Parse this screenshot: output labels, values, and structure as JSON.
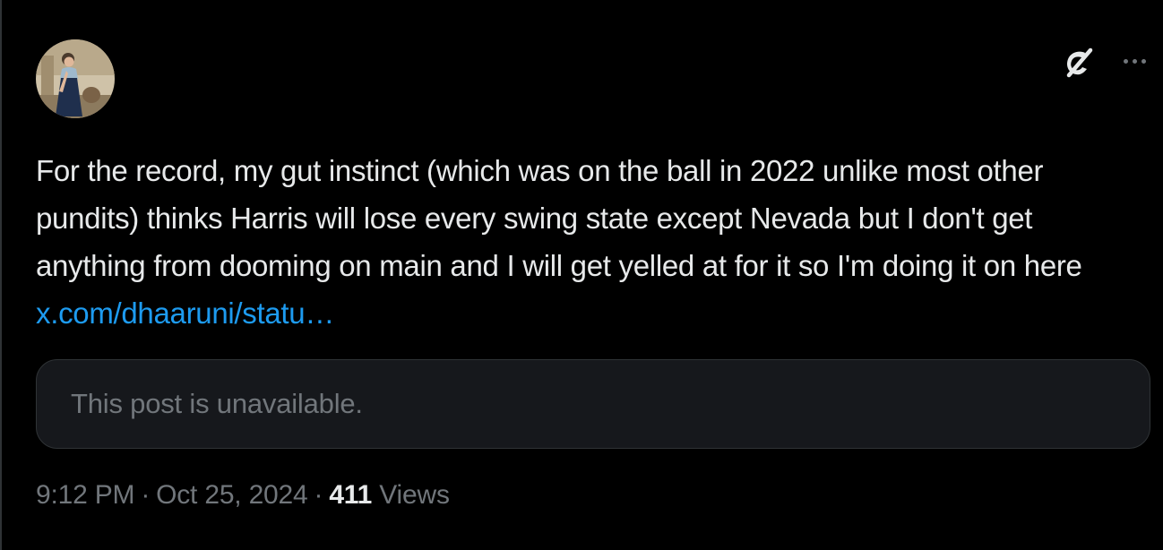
{
  "tweet": {
    "text": "For the record, my gut instinct (which was on the ball in 2022 unlike most other pundits) thinks Harris will lose every swing state except Nevada but I don't get anything from dooming on main and I will get yelled at for it so I'm doing it on here ",
    "link": "x.com/dhaaruni/statu…",
    "quoted_post": {
      "unavailable_text": "This post is unavailable."
    },
    "time": "9:12 PM",
    "separator": "·",
    "date": "Oct 25, 2024",
    "views_count": "411",
    "views_label": "Views"
  },
  "icons": {
    "grok": "grok-icon",
    "more": "more-icon"
  },
  "colors": {
    "background": "#000000",
    "text": "#e7e9ea",
    "muted": "#71767b",
    "link": "#1d9bf0",
    "card": "#16181c",
    "border": "#2f3336"
  }
}
